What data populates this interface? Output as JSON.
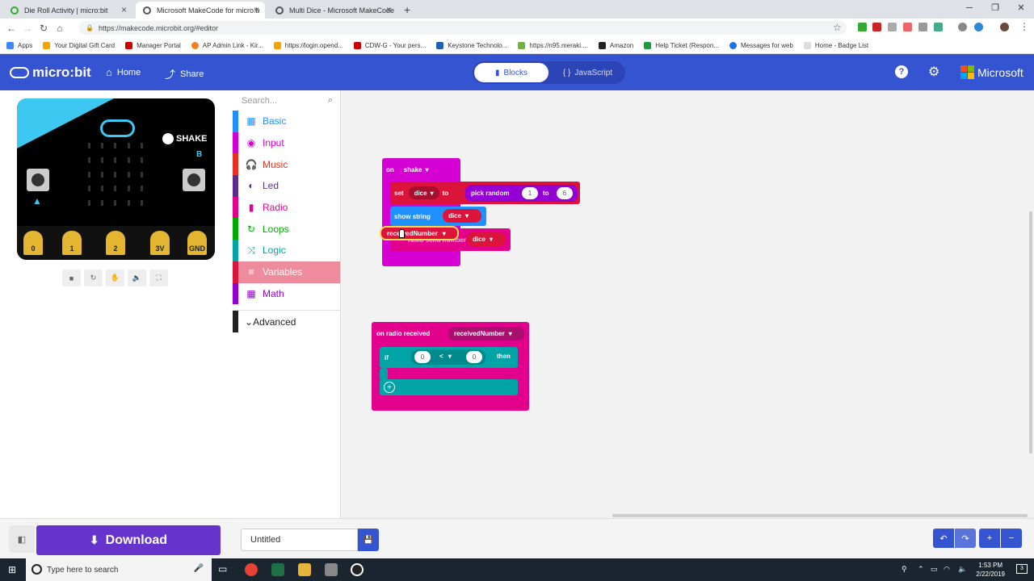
{
  "browser": {
    "tabs": [
      {
        "title": "Die Roll Activity | micro:bit",
        "active": false
      },
      {
        "title": "Microsoft MakeCode for micro:b",
        "active": true
      },
      {
        "title": "Multi Dice - Microsoft MakeCode",
        "active": false
      }
    ],
    "url": "https://makecode.microbit.org/#editor",
    "bookmarks": [
      "Apps",
      "Your Digital Gift Card",
      "Manager Portal",
      "AP Admin Link - Kir...",
      "https://login.opend...",
      "CDW-G - Your pers...",
      "Keystone Technolo...",
      "https://n95.meraki....",
      "Amazon",
      "Help Ticket (Respon...",
      "Messages for web",
      "Home - Badge List"
    ]
  },
  "header": {
    "logo": "micro:bit",
    "home": "Home",
    "share": "Share",
    "blocks": "Blocks",
    "javascript": "JavaScript",
    "brand": "Microsoft"
  },
  "simulator": {
    "shake": "SHAKE",
    "pins": [
      "0",
      "1",
      "2",
      "3V",
      "GND"
    ]
  },
  "toolbox": {
    "search_placeholder": "Search...",
    "categories": [
      {
        "label": "Basic",
        "color": "#1e90ff",
        "icon": "▦"
      },
      {
        "label": "Input",
        "color": "#d400d4",
        "icon": "◉"
      },
      {
        "label": "Music",
        "color": "#e63022",
        "icon": "🎧"
      },
      {
        "label": "Led",
        "color": "#5c2d91",
        "icon": "◐"
      },
      {
        "label": "Radio",
        "color": "#e3008c",
        "icon": "▮"
      },
      {
        "label": "Loops",
        "color": "#00aa00",
        "icon": "↻"
      },
      {
        "label": "Logic",
        "color": "#00a4a6",
        "icon": "⤨"
      },
      {
        "label": "Variables",
        "color": "#dc143c",
        "icon": "≡"
      },
      {
        "label": "Math",
        "color": "#9400d3",
        "icon": "▦"
      }
    ],
    "selected": "Variables",
    "advanced": "Advanced"
  },
  "blocks": {
    "on_shake": {
      "on": "on",
      "event": "shake"
    },
    "set": {
      "set": "set",
      "var": "dice",
      "to": "to",
      "pick_random": "pick random",
      "from": "1",
      "to_word": "to",
      "upto": "6"
    },
    "show_string": {
      "label": "show string",
      "var": "dice"
    },
    "radio_send": {
      "label": "radio send number",
      "var": "dice"
    },
    "dragging": {
      "label": "receivedNumber"
    },
    "on_radio": {
      "label": "on radio received",
      "param": "receivedNumber"
    },
    "if_block": {
      "if": "if",
      "left": "0",
      "op": "<",
      "right": "0",
      "then": "then"
    }
  },
  "bottom": {
    "download": "Download",
    "project_name": "Untitled"
  },
  "taskbar": {
    "search_placeholder": "Type here to search",
    "time": "1:53 PM",
    "date": "2/22/2019",
    "notifications": "3"
  }
}
